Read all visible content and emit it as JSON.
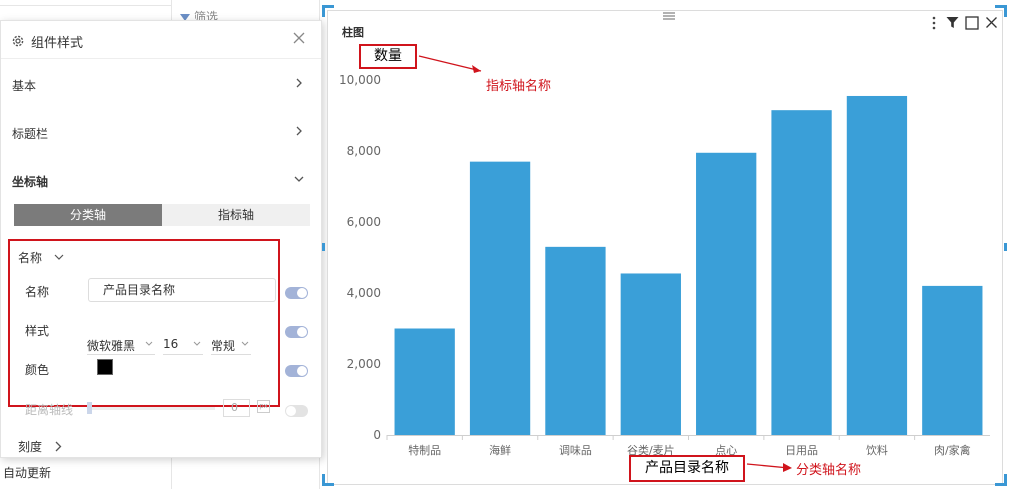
{
  "background": {
    "filter_label": "筛选",
    "auto_update_label": "自动更新"
  },
  "panel": {
    "title": "组件样式",
    "sections": {
      "basic": "基本",
      "title_bar": "标题栏",
      "axis": "坐标轴"
    },
    "tabs": {
      "category_axis": "分类轴",
      "value_axis": "指标轴"
    },
    "name_section": {
      "title": "名称",
      "name_label": "名称",
      "name_value": "产品目录名称",
      "style_label": "样式",
      "font_family": "微软雅黑",
      "font_size": "16",
      "font_weight": "常规",
      "color_label": "颜色",
      "color_value": "#000000"
    },
    "distance_label": "距离轴线",
    "distance_value": "0",
    "distance_unit": "px",
    "scale_label": "刻度",
    "toggles": {
      "name_toggle": true,
      "style_toggle": true,
      "color_toggle": true,
      "distance_toggle": false
    }
  },
  "card": {
    "title": "柱图"
  },
  "annotations": {
    "value_axis_box": "数量",
    "value_axis_note": "指标轴名称",
    "category_axis_box": "产品目录名称",
    "category_axis_note": "分类轴名称"
  },
  "colors": {
    "bar": "#3a9fd8",
    "accent": "#3a97d4",
    "annotation_red": "#d0141c",
    "toggle_on": "#a3b3d8"
  },
  "chart_data": {
    "type": "bar",
    "title": "柱图",
    "ylabel": "数量",
    "xlabel": "产品目录名称",
    "categories": [
      "特制品",
      "海鲜",
      "调味品",
      "谷类/麦片",
      "点心",
      "日用品",
      "饮料",
      "肉/家禽"
    ],
    "values": [
      3000,
      7700,
      5300,
      4550,
      7950,
      9150,
      9550,
      4200
    ],
    "ylim": [
      0,
      10000
    ],
    "yticks": [
      "0",
      "2,000",
      "4,000",
      "6,000",
      "8,000",
      "10,000"
    ],
    "ytick_values": [
      0,
      2000,
      4000,
      6000,
      8000,
      10000
    ],
    "grid": false,
    "legend": "none"
  }
}
